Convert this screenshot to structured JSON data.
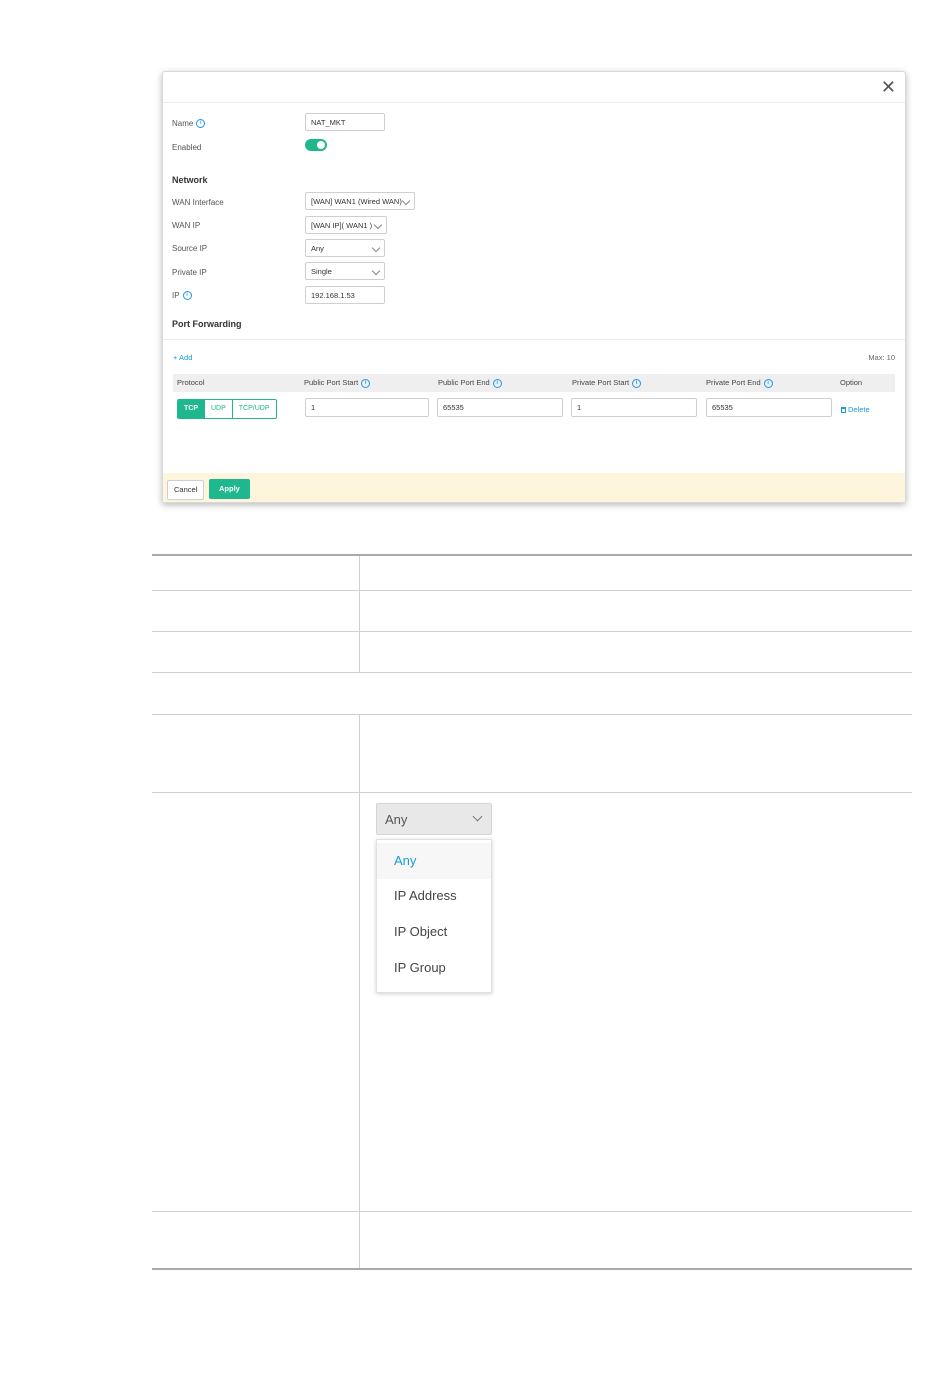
{
  "dialog": {
    "close_glyph": "✕",
    "fields": {
      "name_label": "Name",
      "name_value": "NAT_MKT",
      "enabled_label": "Enabled",
      "enabled": true
    },
    "network": {
      "section_title": "Network",
      "wan_interface_label": "WAN Interface",
      "wan_interface_value": "[WAN] WAN1 (Wired WAN)",
      "wan_ip_label": "WAN IP",
      "wan_ip_value": "[WAN IP]( WAN1 )",
      "source_ip_label": "Source IP",
      "source_ip_value": "Any",
      "private_ip_label": "Private IP",
      "private_ip_value": "Single",
      "ip_label": "IP",
      "ip_value": "192.168.1.53"
    },
    "port_forwarding": {
      "section_title": "Port Forwarding",
      "add_label": "+ Add",
      "max_label": "Max: 10",
      "columns": [
        "Protocol",
        "Public Port Start",
        "Public Port End",
        "Private Port Start",
        "Private Port End",
        "Option"
      ],
      "protocols": [
        "TCP",
        "UDP",
        "TCP/UDP"
      ],
      "active_protocol": "TCP",
      "row": {
        "public_start": "1",
        "public_end": "65535",
        "private_start": "1",
        "private_end": "65535",
        "delete_label": "Delete"
      }
    },
    "footer": {
      "cancel_label": "Cancel",
      "apply_label": "Apply"
    },
    "accent_color": "#1fb88e",
    "link_color": "#1a9ad6",
    "footer_color": "#fdf5dc"
  },
  "dropdown_zoom": {
    "selected": "Any",
    "options": [
      "Any",
      "IP Address",
      "IP Object",
      "IP Group"
    ]
  }
}
